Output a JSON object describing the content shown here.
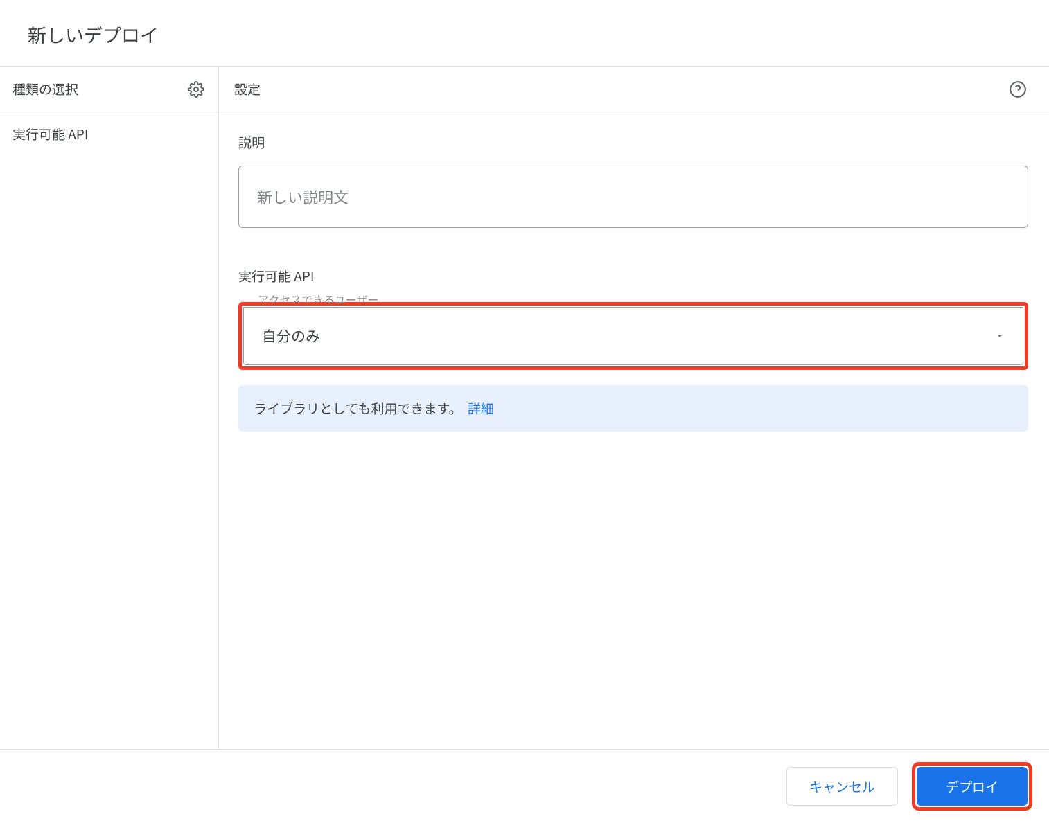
{
  "dialog": {
    "title": "新しいデプロイ"
  },
  "sidebar": {
    "header": "種類の選択",
    "item": "実行可能 API"
  },
  "main": {
    "header": "設定",
    "description": {
      "label": "説明",
      "placeholder": "新しい説明文"
    },
    "api": {
      "title": "実行可能 API",
      "access_label": "アクセスできるユーザー",
      "dropdown_value": "自分のみ"
    },
    "info": {
      "text": "ライブラリとしても利用できます。",
      "link": "詳細"
    }
  },
  "footer": {
    "cancel": "キャンセル",
    "deploy": "デプロイ"
  }
}
